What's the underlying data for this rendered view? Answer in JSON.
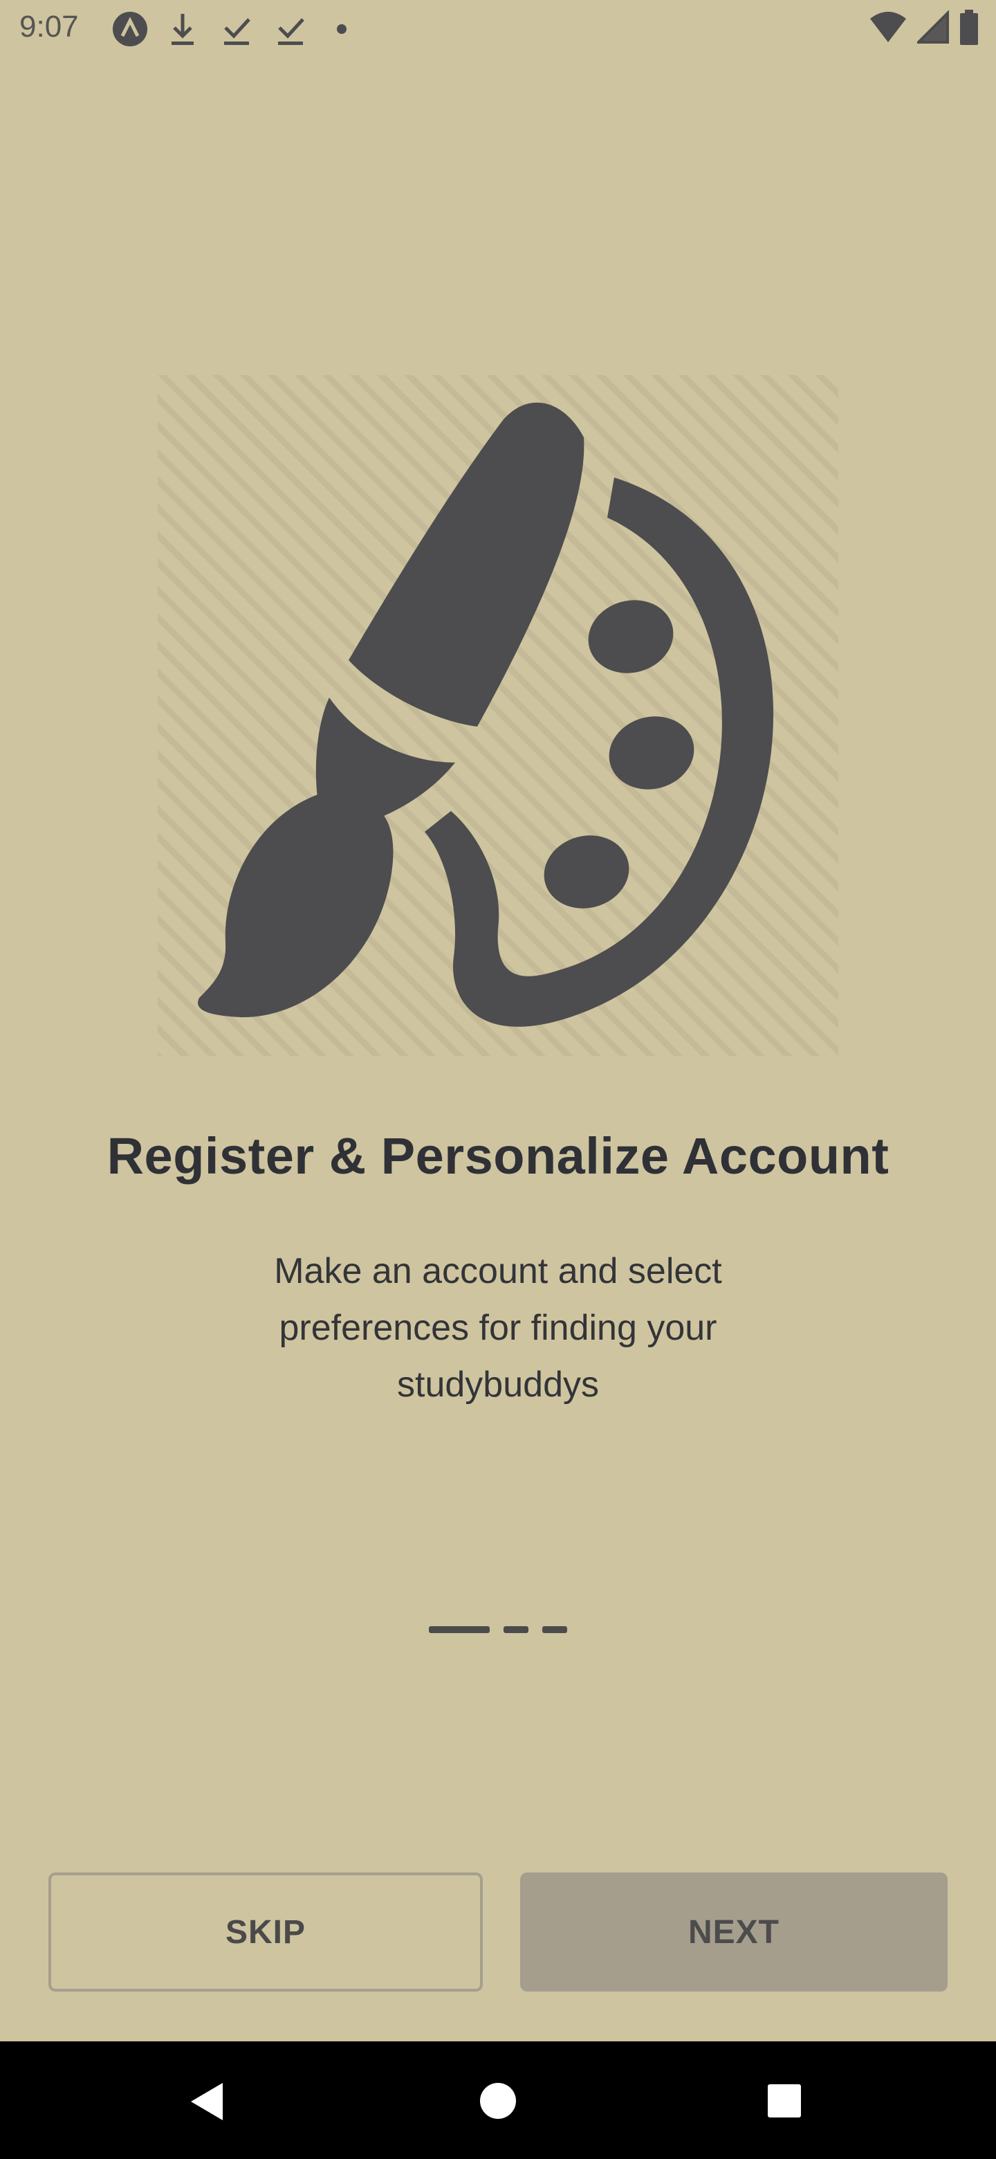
{
  "status_bar": {
    "time": "9:07",
    "left_icons": [
      "app-notification-icon",
      "download-icon",
      "download-done-icon",
      "download-done-icon",
      "dot-icon"
    ],
    "right_icons": [
      "wifi-icon",
      "signal-icon",
      "battery-icon"
    ]
  },
  "onboarding": {
    "illustration": "palette-brush-icon",
    "title": "Register & Personalize Account",
    "subtitle_lines": [
      "Make an account and select",
      "preferences for finding your",
      "studybuddys"
    ],
    "pager": {
      "current": 1,
      "total": 3
    }
  },
  "actions": {
    "skip_label": "SKIP",
    "next_label": "NEXT"
  },
  "nav_bar": {
    "buttons": [
      "back-icon",
      "home-icon",
      "recents-icon"
    ]
  },
  "colors": {
    "background": "#cec49f",
    "icon": "#4d4d4f",
    "next_button": "#a59e8d",
    "nav_bar": "#000000"
  }
}
